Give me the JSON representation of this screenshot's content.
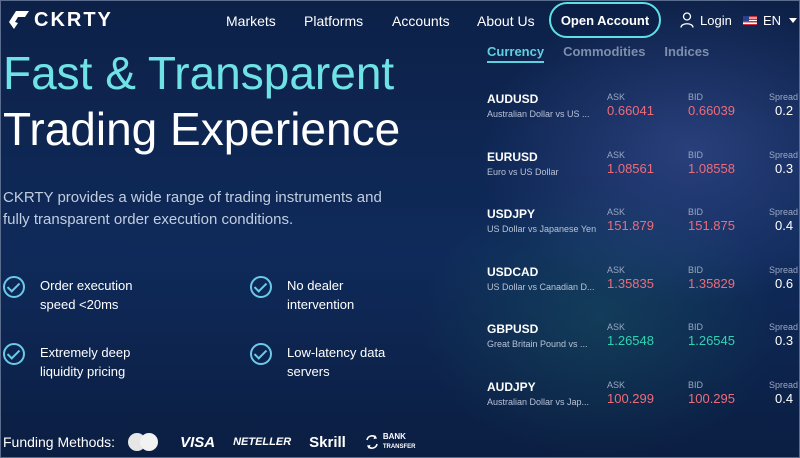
{
  "nav": {
    "logo": "CKRTY",
    "links": [
      "Markets",
      "Platforms",
      "Accounts",
      "About Us"
    ],
    "open_account": "Open Account",
    "login": "Login",
    "lang": "EN"
  },
  "hero": {
    "line1": "Fast & Transparent",
    "line2": "Trading Experience",
    "desc": "CKRTY provides a wide range of trading instruments and fully transparent order execution conditions.",
    "features": [
      "Order execution speed <20ms",
      "No dealer intervention",
      "Extremely deep liquidity pricing",
      "Low-latency data servers"
    ]
  },
  "funding": {
    "label": "Funding Methods:",
    "visa": "VISA",
    "neteller": "NETELLER",
    "skrill": "Skrill",
    "bank_line1": "BANK",
    "bank_line2": "TRANSFER"
  },
  "quotes": {
    "tabs": [
      "Currency",
      "Commodities",
      "Indices"
    ],
    "ask_label": "ASK",
    "bid_label": "BID",
    "spread_label": "Spread",
    "rows": [
      {
        "symbol": "AUDUSD",
        "name": "Australian Dollar vs US ...",
        "ask": "0.66041",
        "bid": "0.66039",
        "spread": "0.2",
        "ask_color": "red",
        "bid_color": "red"
      },
      {
        "symbol": "EURUSD",
        "name": "Euro vs US Dollar",
        "ask": "1.08561",
        "bid": "1.08558",
        "spread": "0.3",
        "ask_color": "red",
        "bid_color": "red"
      },
      {
        "symbol": "USDJPY",
        "name": "US Dollar vs Japanese Yen",
        "ask": "151.879",
        "bid": "151.875",
        "spread": "0.4",
        "ask_color": "red",
        "bid_color": "red"
      },
      {
        "symbol": "USDCAD",
        "name": "US Dollar vs Canadian D...",
        "ask": "1.35835",
        "bid": "1.35829",
        "spread": "0.6",
        "ask_color": "red",
        "bid_color": "red"
      },
      {
        "symbol": "GBPUSD",
        "name": "Great Britain Pound vs ...",
        "ask": "1.26548",
        "bid": "1.26545",
        "spread": "0.3",
        "ask_color": "green",
        "bid_color": "green"
      },
      {
        "symbol": "AUDJPY",
        "name": "Australian Dollar vs Jap...",
        "ask": "100.299",
        "bid": "100.295",
        "spread": "0.4",
        "ask_color": "red",
        "bid_color": "red"
      }
    ]
  },
  "colors": {
    "accent": "#6fe2e6",
    "down": "#ee6c7a",
    "up": "#2fd3b2",
    "background": "#0c1f45"
  }
}
